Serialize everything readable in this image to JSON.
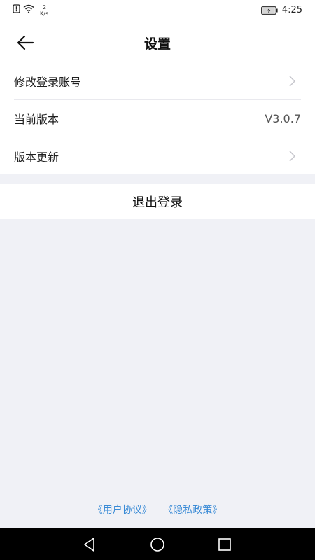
{
  "status_bar": {
    "net_speed_value": "2",
    "net_speed_unit": "K/s",
    "time": "4:25",
    "icons": [
      "sim-alert-icon",
      "wifi-icon",
      "battery-charging-icon"
    ]
  },
  "header": {
    "title": "设置",
    "back_icon": "back-arrow-icon"
  },
  "settings": {
    "items": [
      {
        "label": "修改登录账号",
        "value": "",
        "icon": "chevron-right-icon"
      },
      {
        "label": "当前版本",
        "value": "V3.0.7"
      },
      {
        "label": "版本更新",
        "value": "",
        "icon": "chevron-right-icon"
      }
    ]
  },
  "logout": {
    "label": "退出登录"
  },
  "footer": {
    "user_agreement": "《用户协议》",
    "privacy_policy": "《隐私政策》",
    "link_color": "#3a8bd6"
  },
  "nav_bar": {
    "icons": [
      "back-triangle-icon",
      "home-circle-icon",
      "recents-square-icon"
    ]
  }
}
